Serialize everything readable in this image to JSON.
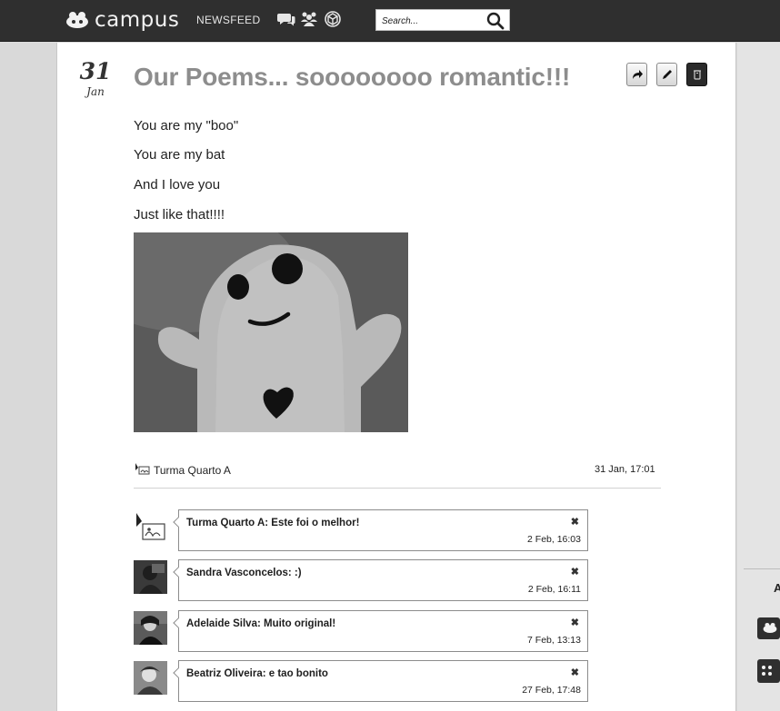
{
  "topbar": {
    "brand": "campus",
    "nav_newsfeed": "NEWSFEED",
    "icons": [
      "chat-icon",
      "people-icon",
      "cube-icon"
    ],
    "search_placeholder": "Search..."
  },
  "post": {
    "date_day": "31",
    "date_month": "Jan",
    "title": "Our Poems... soooooooo romantic!!!",
    "actions": [
      "share-icon",
      "edit-icon",
      "delete-icon"
    ],
    "lines": [
      "You are my \"boo\"",
      "You are my bat",
      "And I love you",
      "Just like that!!!!"
    ],
    "author": "Turma Quarto A",
    "time": "31 Jan, 17:01"
  },
  "comments": [
    {
      "text": "Turma Quarto A: Este foi o melhor!",
      "time": "2 Feb, 16:03"
    },
    {
      "text": "Sandra Vasconcelos: :)",
      "time": "2 Feb, 16:11"
    },
    {
      "text": "Adelaide Silva: Muito original!",
      "time": "7 Feb, 13:13"
    },
    {
      "text": "Beatriz Oliveira: e tao bonito",
      "time": "27 Feb, 17:48"
    }
  ],
  "comment_close": "✖",
  "sidebar": {
    "letter": "A"
  }
}
